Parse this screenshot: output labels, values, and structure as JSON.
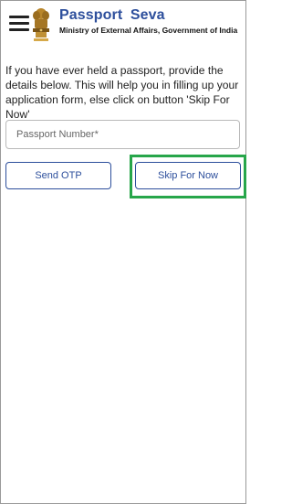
{
  "header": {
    "title": "Passport  Seva",
    "subtitle": "Ministry of External Affairs, Government of India",
    "menu_icon": "hamburger-menu-icon",
    "emblem_icon": "national-emblem-icon",
    "brand_color": "#2d4f9c"
  },
  "main": {
    "intro_text": "If you have ever held a passport, provide the details below. This will help you in filling up your application form, else click on button 'Skip For Now'",
    "passport_field": {
      "placeholder": "Passport Number*",
      "value": ""
    },
    "send_otp_label": "Send OTP",
    "skip_label": "Skip For Now"
  },
  "highlight_color": "#27a64a"
}
